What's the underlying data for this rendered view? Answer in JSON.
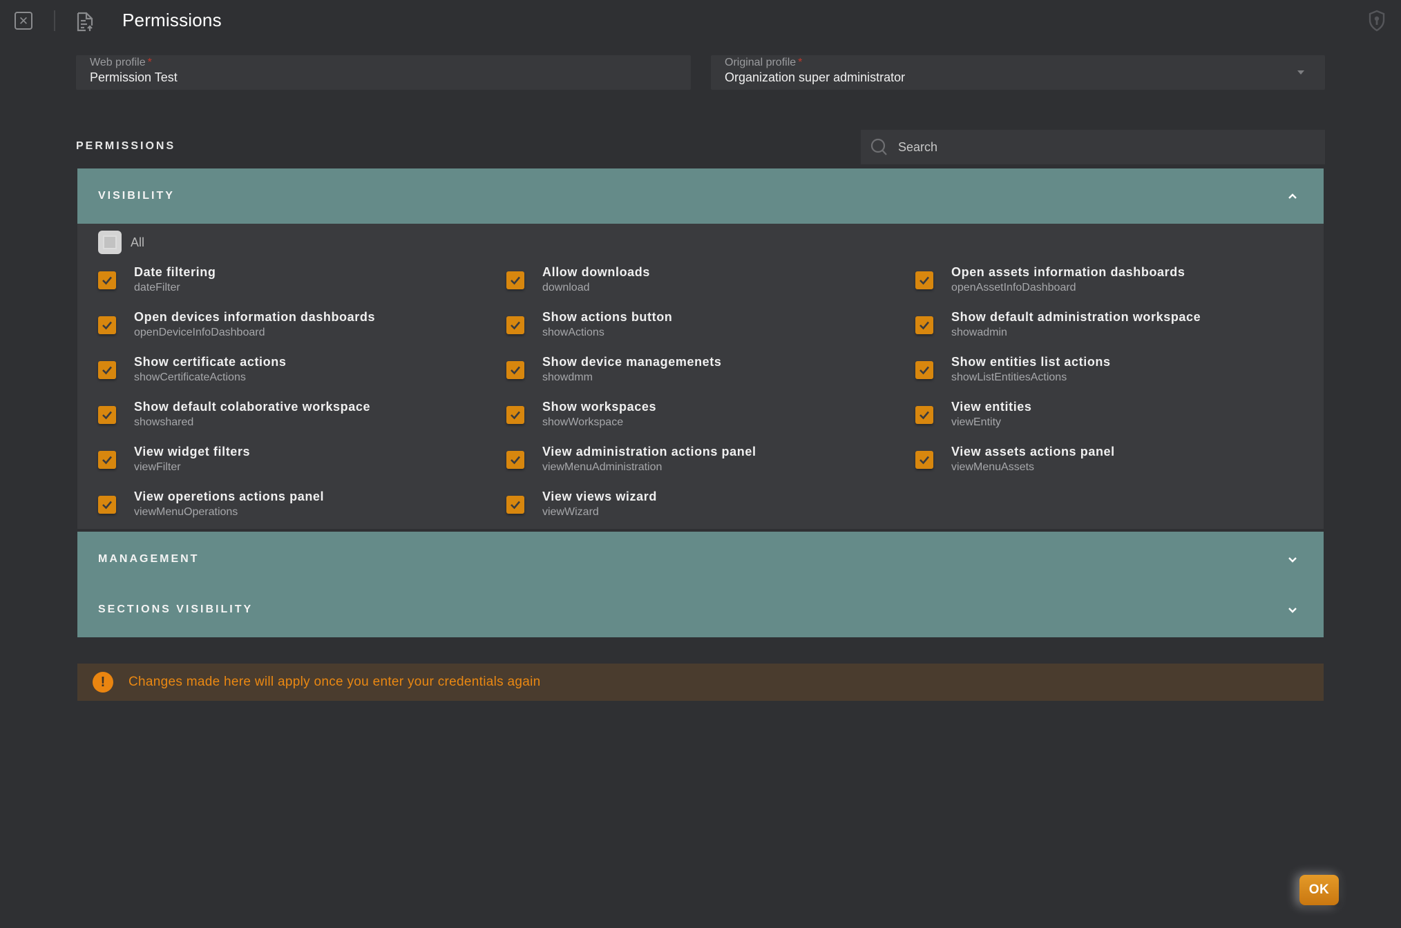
{
  "header": {
    "title": "Permissions",
    "close_icon": "close-square-icon",
    "document_icon": "document-upload-icon",
    "shield_icon": "shield-keyhole-icon"
  },
  "form": {
    "web_profile": {
      "label": "Web profile",
      "required_mark": "*",
      "value": "Permission Test"
    },
    "original_profile": {
      "label": "Original profile",
      "required_mark": "*",
      "value": "Organization super administrator"
    }
  },
  "permissions": {
    "heading": "PERMISSIONS",
    "search": {
      "placeholder": "Search",
      "value": ""
    },
    "sections": [
      {
        "title": "VISIBILITY",
        "expanded": true,
        "all_label": "All",
        "all_checked": false,
        "items": [
          {
            "label": "Date filtering",
            "key": "dateFilter",
            "checked": true
          },
          {
            "label": "Allow downloads",
            "key": "download",
            "checked": true
          },
          {
            "label": "Open assets information dashboards",
            "key": "openAssetInfoDashboard",
            "checked": true
          },
          {
            "label": "Open devices information dashboards",
            "key": "openDeviceInfoDashboard",
            "checked": true
          },
          {
            "label": "Show actions button",
            "key": "showActions",
            "checked": true
          },
          {
            "label": "Show default administration workspace",
            "key": "showadmin",
            "checked": true
          },
          {
            "label": "Show certificate actions",
            "key": "showCertificateActions",
            "checked": true
          },
          {
            "label": "Show device managemenets",
            "key": "showdmm",
            "checked": true
          },
          {
            "label": "Show entities list actions",
            "key": "showListEntitiesActions",
            "checked": true
          },
          {
            "label": "Show default colaborative workspace",
            "key": "showshared",
            "checked": true
          },
          {
            "label": "Show workspaces",
            "key": "showWorkspace",
            "checked": true
          },
          {
            "label": "View entities",
            "key": "viewEntity",
            "checked": true
          },
          {
            "label": "View widget filters",
            "key": "viewFilter",
            "checked": true
          },
          {
            "label": "View administration actions panel",
            "key": "viewMenuAdministration",
            "checked": true
          },
          {
            "label": "View assets actions panel",
            "key": "viewMenuAssets",
            "checked": true
          },
          {
            "label": "View operetions actions panel",
            "key": "viewMenuOperations",
            "checked": true
          },
          {
            "label": "View views wizard",
            "key": "viewWizard",
            "checked": true
          }
        ]
      },
      {
        "title": "MANAGEMENT",
        "expanded": false
      },
      {
        "title": "SECTIONS VISIBILITY",
        "expanded": false
      }
    ]
  },
  "warning": {
    "icon": "exclamation-circle-icon",
    "text": "Changes made here will apply once you enter your credentials again"
  },
  "actions": {
    "ok_label": "OK"
  },
  "colors": {
    "background": "#2f3033",
    "accordion_header": "#658b89",
    "checkbox_accent": "#d8870e",
    "warning_text": "#ea8812",
    "warning_bg": "#4a3c2e"
  }
}
